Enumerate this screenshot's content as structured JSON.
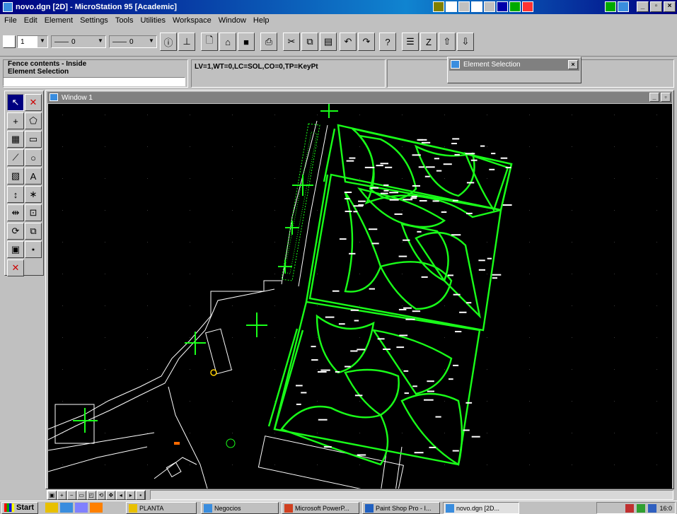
{
  "window": {
    "title": "novo.dgn [2D] - MicroStation 95 [Academic]"
  },
  "menu": [
    "File",
    "Edit",
    "Element",
    "Settings",
    "Tools",
    "Utilities",
    "Workspace",
    "Window",
    "Help"
  ],
  "toolbar": {
    "level_value": "1",
    "style_value": "0",
    "weight_value": "0"
  },
  "status": {
    "line1": "Fence contents - Inside",
    "line2": "Element Selection",
    "attributes": "LV=1,WT=0,LC=SOL,CO=0,TP=KeyPt"
  },
  "element_selection_dialog": {
    "title": "Element Selection"
  },
  "view_window": {
    "title": "Window 1"
  },
  "taskbar": {
    "start_label": "Start",
    "tasks": [
      {
        "label": "PLANTA"
      },
      {
        "label": "Negocios"
      },
      {
        "label": "Microsoft PowerP..."
      },
      {
        "label": "Paint Shop Pro - I..."
      },
      {
        "label": "novo.dgn [2D..."
      }
    ],
    "clock": "16:0"
  },
  "colors": {
    "drawing_green": "#19ff19",
    "drawing_white": "#ffffff",
    "title_blue": "#000080",
    "canvas_bg": "#000000"
  }
}
